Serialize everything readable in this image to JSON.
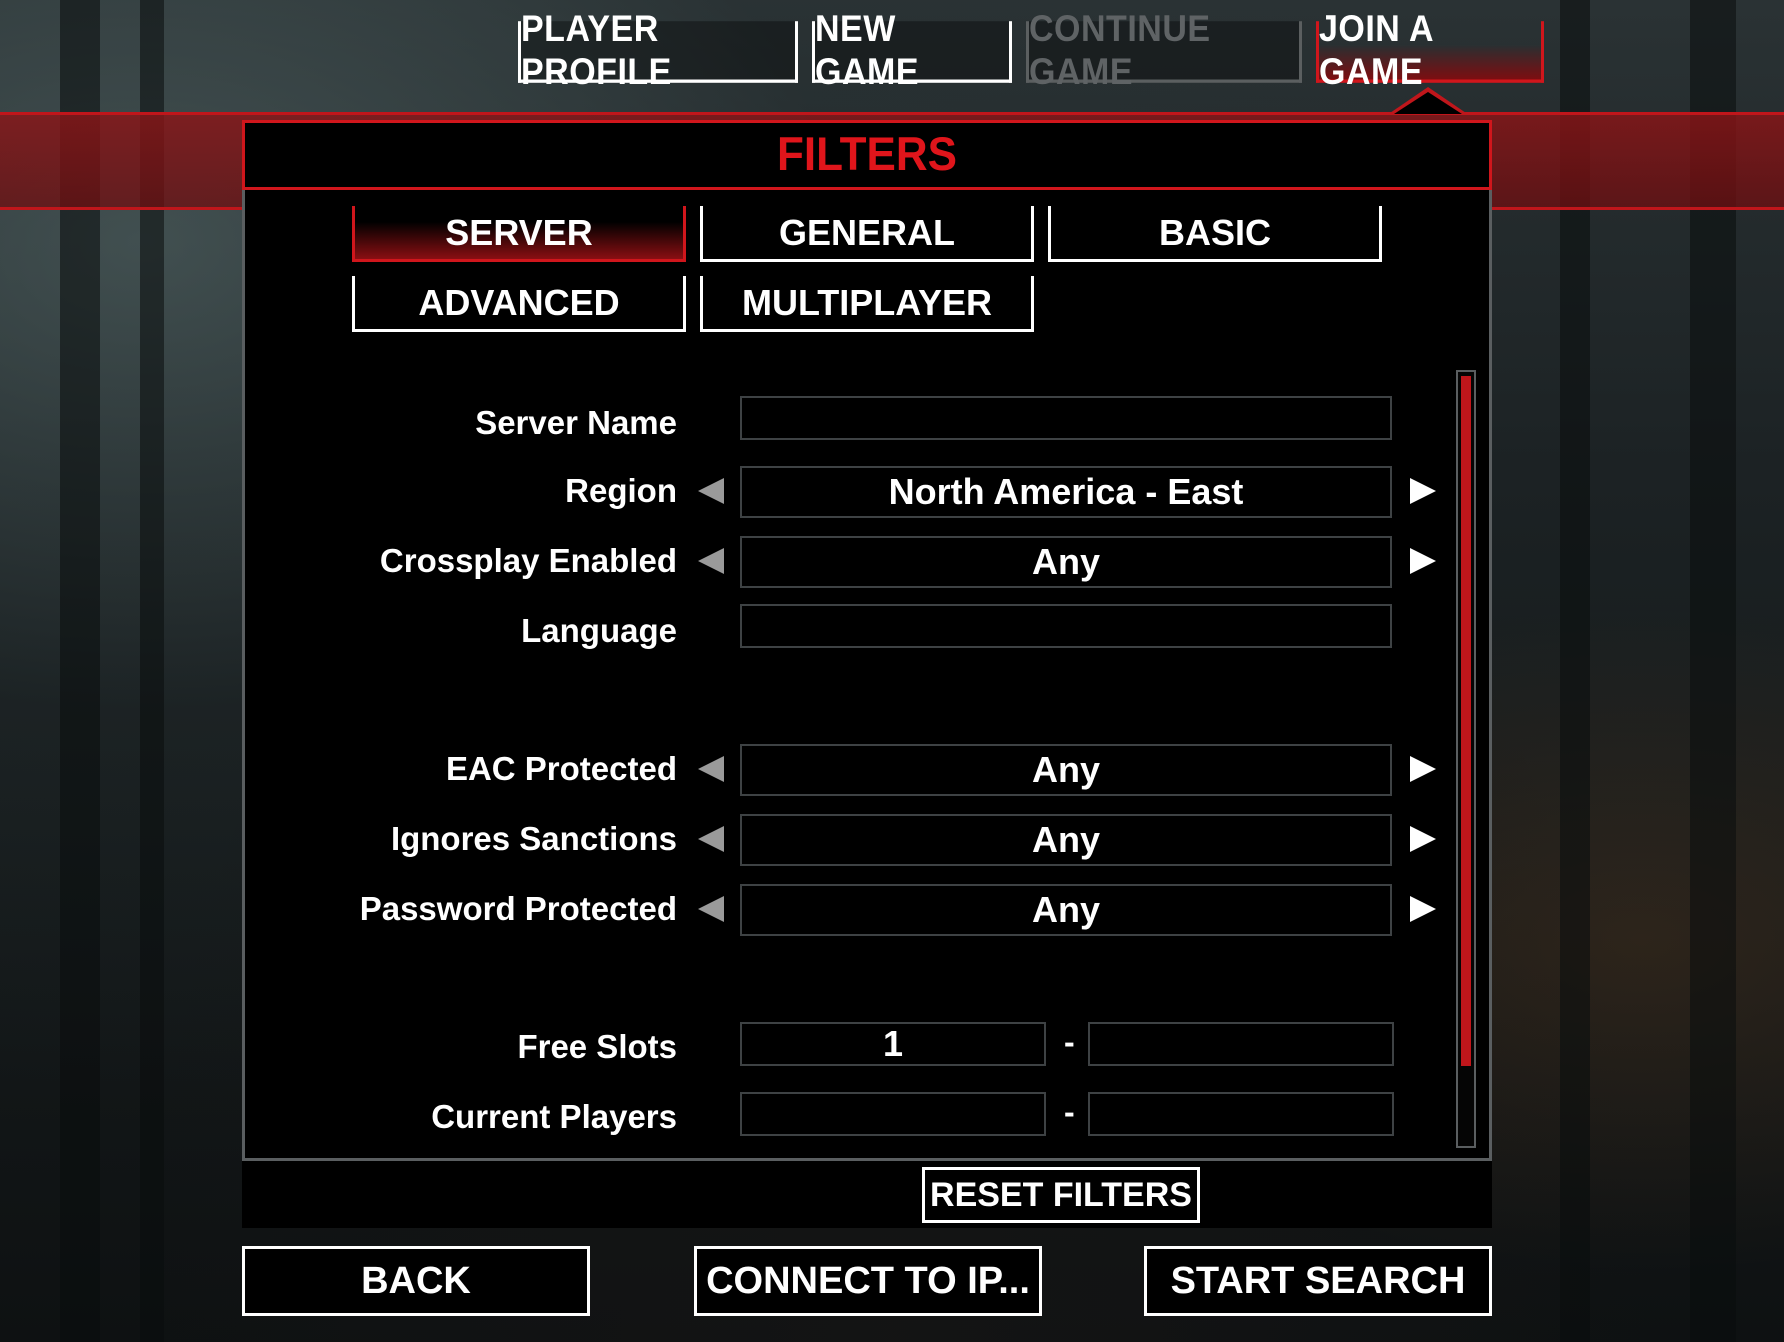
{
  "top_tabs": [
    {
      "label": "PLAYER PROFILE",
      "state": "normal"
    },
    {
      "label": "NEW GAME",
      "state": "normal"
    },
    {
      "label": "CONTINUE GAME",
      "state": "disabled"
    },
    {
      "label": "JOIN A GAME",
      "state": "active"
    }
  ],
  "panel": {
    "title": "FILTERS",
    "sub_tabs": [
      {
        "label": "SERVER",
        "state": "active"
      },
      {
        "label": "GENERAL",
        "state": "normal"
      },
      {
        "label": "BASIC",
        "state": "normal"
      },
      {
        "label": "ADVANCED",
        "state": "normal"
      },
      {
        "label": "MULTIPLAYER",
        "state": "normal"
      }
    ],
    "filters": {
      "server_name": {
        "label": "Server Name",
        "value": ""
      },
      "region": {
        "label": "Region",
        "value": "North America - East"
      },
      "crossplay": {
        "label": "Crossplay Enabled",
        "value": "Any"
      },
      "language": {
        "label": "Language",
        "value": ""
      },
      "eac": {
        "label": "EAC Protected",
        "value": "Any"
      },
      "sanctions": {
        "label": "Ignores Sanctions",
        "value": "Any"
      },
      "password": {
        "label": "Password Protected",
        "value": "Any"
      },
      "free_slots": {
        "label": "Free Slots",
        "min": "1",
        "max": "",
        "separator": "-"
      },
      "current_players": {
        "label": "Current Players",
        "min": "",
        "max": "",
        "separator": "-"
      }
    },
    "reset_label": "RESET FILTERS"
  },
  "bottom_buttons": {
    "back": "BACK",
    "connect": "CONNECT TO IP...",
    "start": "START SEARCH"
  },
  "colors": {
    "accent_red": "#d0161c",
    "text": "#ffffff",
    "disabled": "#5f6365",
    "panel_bg": "#000000"
  }
}
